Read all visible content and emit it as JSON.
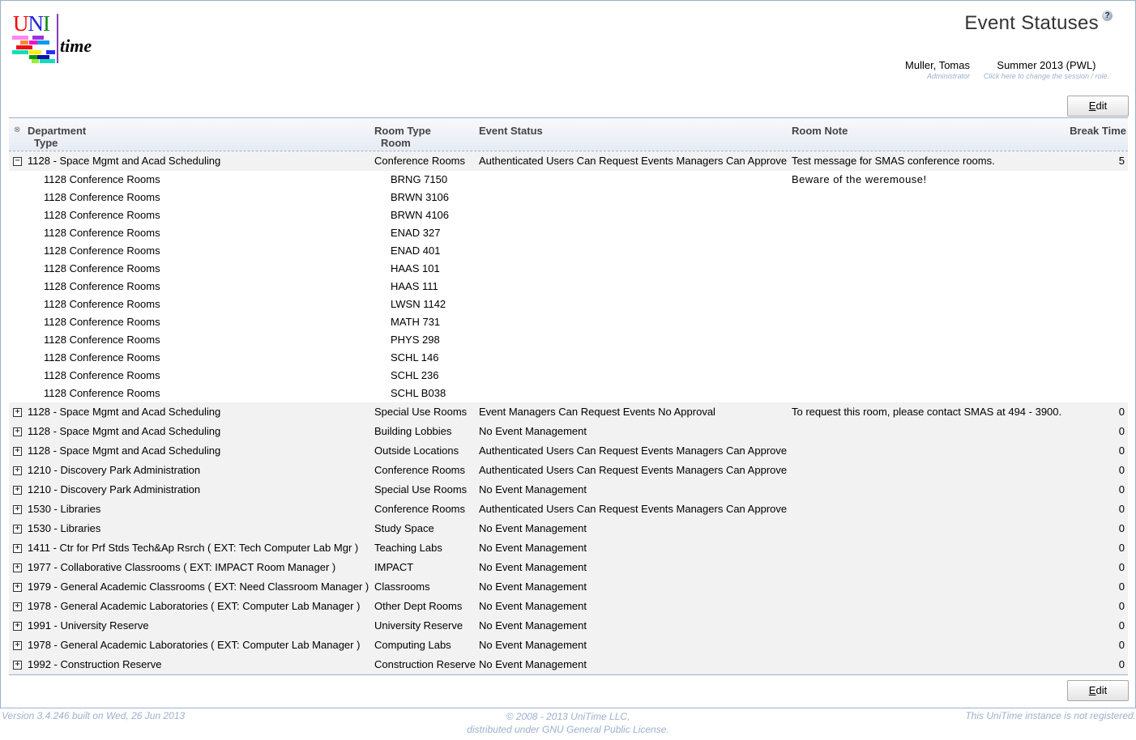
{
  "logo": {
    "u": "U",
    "n": "N",
    "i": "I",
    "time": "time"
  },
  "header": {
    "title": "Event Statuses",
    "help_icon": "?",
    "user_name": "Muller, Tomas",
    "user_role": "Administrator",
    "session_name": "Summer 2013 (PWL)",
    "session_hint": "Click here to change the session / role."
  },
  "toolbar": {
    "edit_label_accesskey": "E",
    "edit_label_rest": "dit"
  },
  "table": {
    "collapse_all_icon": "⊗",
    "columns": {
      "department": "Department",
      "department_sub": "Type",
      "room_type": "Room Type",
      "room_type_sub": "Room",
      "event_status": "Event Status",
      "room_note": "Room Note",
      "break_time": "Break Time"
    },
    "expanded_group": {
      "department": "1128 - Space Mgmt and Acad Scheduling",
      "room_type": "Conference Rooms",
      "event_status": "Authenticated Users Can Request Events Managers Can Approve",
      "room_note": "Test message for SMAS conference rooms.",
      "break_time": "5",
      "rooms": [
        {
          "type": "1128 Conference Rooms",
          "room": "BRNG 7150",
          "note": "Beware of the weremouse!"
        },
        {
          "type": "1128 Conference Rooms",
          "room": "BRWN 3106",
          "note": ""
        },
        {
          "type": "1128 Conference Rooms",
          "room": "BRWN 4106",
          "note": ""
        },
        {
          "type": "1128 Conference Rooms",
          "room": "ENAD 327",
          "note": ""
        },
        {
          "type": "1128 Conference Rooms",
          "room": "ENAD 401",
          "note": ""
        },
        {
          "type": "1128 Conference Rooms",
          "room": "HAAS 101",
          "note": ""
        },
        {
          "type": "1128 Conference Rooms",
          "room": "HAAS 111",
          "note": ""
        },
        {
          "type": "1128 Conference Rooms",
          "room": "LWSN 1142",
          "note": ""
        },
        {
          "type": "1128 Conference Rooms",
          "room": "MATH 731",
          "note": ""
        },
        {
          "type": "1128 Conference Rooms",
          "room": "PHYS 298",
          "note": ""
        },
        {
          "type": "1128 Conference Rooms",
          "room": "SCHL 146",
          "note": ""
        },
        {
          "type": "1128 Conference Rooms",
          "room": "SCHL 236",
          "note": ""
        },
        {
          "type": "1128 Conference Rooms",
          "room": "SCHL B038",
          "note": ""
        }
      ]
    },
    "groups": [
      {
        "department": "1128 - Space Mgmt and Acad Scheduling",
        "room_type": "Special Use Rooms",
        "event_status": "Event Managers Can Request Events No Approval",
        "room_note": "To request this room, please contact SMAS at 494 - 3900.",
        "break_time": "0"
      },
      {
        "department": "1128 - Space Mgmt and Acad Scheduling",
        "room_type": "Building Lobbies",
        "event_status": "No Event Management",
        "room_note": "",
        "break_time": "0"
      },
      {
        "department": "1128 - Space Mgmt and Acad Scheduling",
        "room_type": "Outside Locations",
        "event_status": "Authenticated Users Can Request Events Managers Can Approve",
        "room_note": "",
        "break_time": "0"
      },
      {
        "department": "1210 - Discovery Park Administration",
        "room_type": "Conference Rooms",
        "event_status": "Authenticated Users Can Request Events Managers Can Approve",
        "room_note": "",
        "break_time": "0"
      },
      {
        "department": "1210 - Discovery Park Administration",
        "room_type": "Special Use Rooms",
        "event_status": "No Event Management",
        "room_note": "",
        "break_time": "0"
      },
      {
        "department": "1530 - Libraries",
        "room_type": "Conference Rooms",
        "event_status": "Authenticated Users Can Request Events Managers Can Approve",
        "room_note": "",
        "break_time": "0"
      },
      {
        "department": "1530 - Libraries",
        "room_type": "Study Space",
        "event_status": "No Event Management",
        "room_note": "",
        "break_time": "0"
      },
      {
        "department": "1411 - Ctr for Prf Stds Tech&Ap Rsrch ( EXT: Tech Computer Lab Mgr )",
        "room_type": "Teaching Labs",
        "event_status": "No Event Management",
        "room_note": "",
        "break_time": "0"
      },
      {
        "department": "1977 - Collaborative Classrooms ( EXT: IMPACT Room Manager )",
        "room_type": "IMPACT",
        "event_status": "No Event Management",
        "room_note": "",
        "break_time": "0"
      },
      {
        "department": "1979 - General Academic Classrooms ( EXT: Need Classroom Manager )",
        "room_type": "Classrooms",
        "event_status": "No Event Management",
        "room_note": "",
        "break_time": "0"
      },
      {
        "department": "1978 - General Academic Laboratories ( EXT: Computer Lab Manager )",
        "room_type": "Other Dept Rooms",
        "event_status": "No Event Management",
        "room_note": "",
        "break_time": "0"
      },
      {
        "department": "1991 - University Reserve",
        "room_type": "University Reserve",
        "event_status": "No Event Management",
        "room_note": "",
        "break_time": "0"
      },
      {
        "department": "1978 - General Academic Laboratories ( EXT: Computer Lab Manager )",
        "room_type": "Computing Labs",
        "event_status": "No Event Management",
        "room_note": "",
        "break_time": "0"
      },
      {
        "department": "1992 - Construction Reserve",
        "room_type": "Construction Reserve",
        "event_status": "No Event Management",
        "room_note": "",
        "break_time": "0"
      }
    ]
  },
  "footer": {
    "version": "Version 3.4.246 built on Wed, 26 Jun 2013",
    "copyright_line1": "© 2008 - 2013 UniTime LLC,",
    "copyright_line2": "distributed under GNU General Public License.",
    "registration": "This UniTime instance is not registered."
  }
}
